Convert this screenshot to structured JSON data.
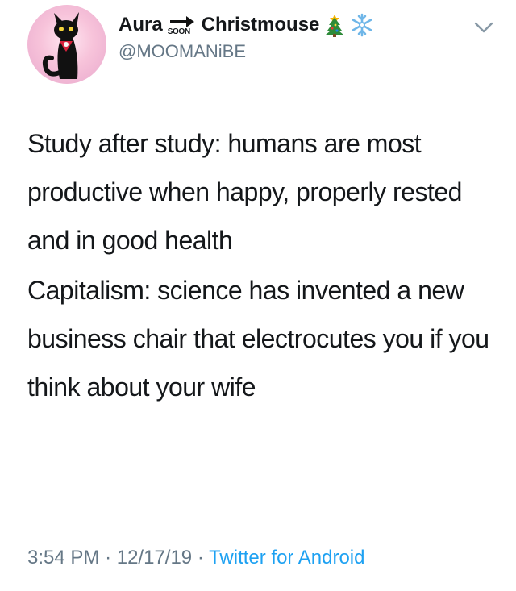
{
  "author": {
    "name_first": "Aura",
    "soon_label": "SOON",
    "name_last": "Christmouse",
    "name_emojis": [
      "christmas-tree-icon",
      "snowflake-icon"
    ],
    "handle": "@MOOMANiBE"
  },
  "tweet": {
    "paragraphs": [
      "Study after study: humans are most productive when happy, properly rested and in good health",
      "Capitalism: science has invented a new business chair that electrocutes you if you think about your wife"
    ]
  },
  "meta": {
    "time": "3:54 PM",
    "separator": "·",
    "date": "12/17/19",
    "source": "Twitter for Android"
  },
  "colors": {
    "text": "#14171a",
    "secondary": "#657786",
    "link": "#1da1f2",
    "background": "#ffffff"
  }
}
